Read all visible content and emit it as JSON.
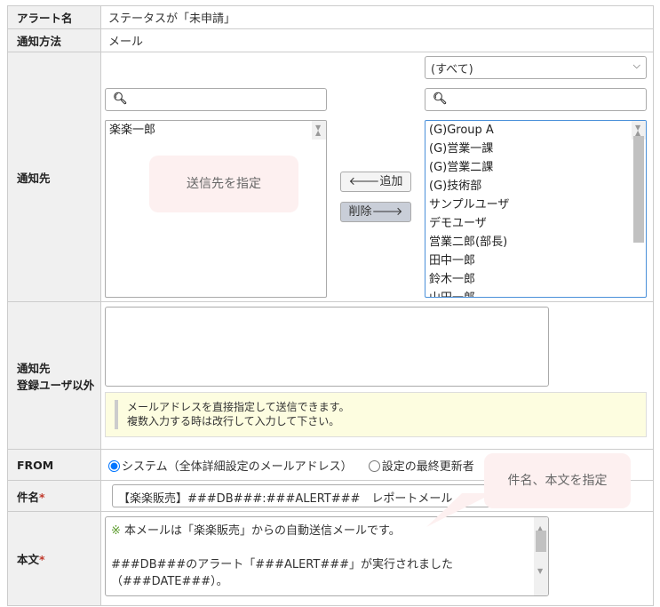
{
  "rows": {
    "alert_name": {
      "label": "アラート名",
      "value": "ステータスが「未申請」"
    },
    "method": {
      "label": "通知方法",
      "value": "メール"
    },
    "recipients": {
      "label": "通知先",
      "left_items": [
        "楽楽一郎"
      ],
      "right_filter": "(すべて)",
      "right_items": [
        "(G)Group A",
        "(G)営業一課",
        "(G)営業二課",
        "(G)技術部",
        "サンプルユーザ",
        "デモユーザ",
        "営業二郎(部長)",
        "田中一郎",
        "鈴木一郎",
        "山田一郎"
      ],
      "add_label": "追加",
      "remove_label": "削除",
      "callout": "送信先を指定"
    },
    "others": {
      "label_line1": "通知先",
      "label_line2": "登録ユーザ以外",
      "textarea": "",
      "note_line1": "メールアドレスを直接指定して送信できます。",
      "note_line2": "複数入力する時は改行して入力して下さい。"
    },
    "from": {
      "label": "FROM",
      "option1": "システム（全体詳細設定のメールアドレス）",
      "option2": "設定の最終更新者",
      "selected": "option1"
    },
    "subject": {
      "label": "件名",
      "required": "*",
      "value": "【楽楽販売】###DB###:###ALERT###　レポートメール",
      "callout": "件名、本文を指定"
    },
    "body": {
      "label": "本文",
      "required": "*",
      "line1_mark": "※",
      "line1": " 本メールは「楽楽販売」からの自動送信メールです。",
      "line3": "###DB###のアラート「###ALERT###」が実行されました",
      "line4": "（###DATE###）。"
    }
  }
}
